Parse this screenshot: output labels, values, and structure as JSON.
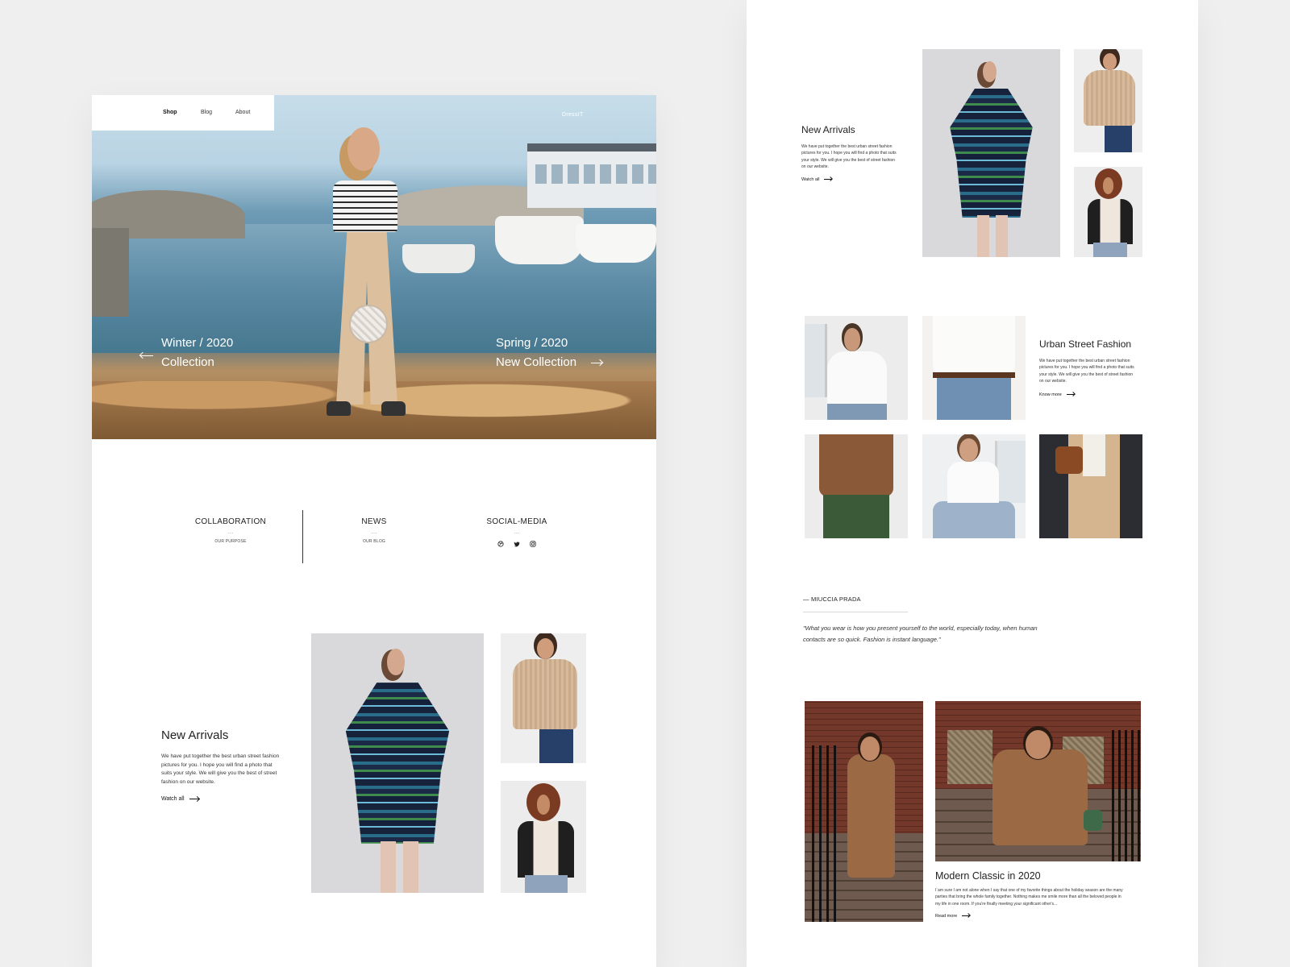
{
  "left": {
    "nav": {
      "shop": "Shop",
      "blog": "Blog",
      "about": "About"
    },
    "brand": "DressIT",
    "hero": {
      "left_caption_1": "Winter / 2020",
      "left_caption_2": "Collection",
      "right_caption_1": "Spring / 2020",
      "right_caption_2": "New Collection"
    },
    "info": [
      {
        "title": "COLLABORATION",
        "dots": "...",
        "sub": "OUR PURPOSE"
      },
      {
        "title": "NEWS",
        "dots": "...",
        "sub": "OUR BLOG"
      },
      {
        "title": "SOCIAL-MEDIA",
        "dots": "...",
        "icons": [
          "dribbble-icon",
          "twitter-icon",
          "instagram-icon"
        ]
      }
    ],
    "new_arrivals": {
      "title": "New Arrivals",
      "text": "We have put together the best urban street fashion pictures for you. I hope you will find a photo that suits your style. We will give you the best of street fashion on our website.",
      "link": "Watch all"
    }
  },
  "right": {
    "new_arrivals": {
      "title": "New Arrivals",
      "text": "We have put together the best urban street fashion pictures for you. I hope you will find a photo that suits your style. We will give you the best of street fashion on our website.",
      "link": "Watch all"
    },
    "urban": {
      "title": "Urban Street Fashion",
      "text": "We have put together the best urban street fashion pictures for you. I hope you will find a photo that suits your style. We will give you the best of street fashion on our website.",
      "link": "Know more"
    },
    "quote": {
      "author": "— MIUCCIA PRADA",
      "text": "\"What you wear is how you present yourself to the world, especially today, when human contacts are so quick. Fashion is instant language.\""
    },
    "modern": {
      "title": "Modern Classic in 2020",
      "text": "I`am sure I am not alone when I say that one of my favorite things about the holiday season are the many parties that bring the whole family together. Nothing makes me smile more than all the beloved people in my life in one room. If you're finally meeting your significant other's...",
      "link": "Read more"
    }
  }
}
